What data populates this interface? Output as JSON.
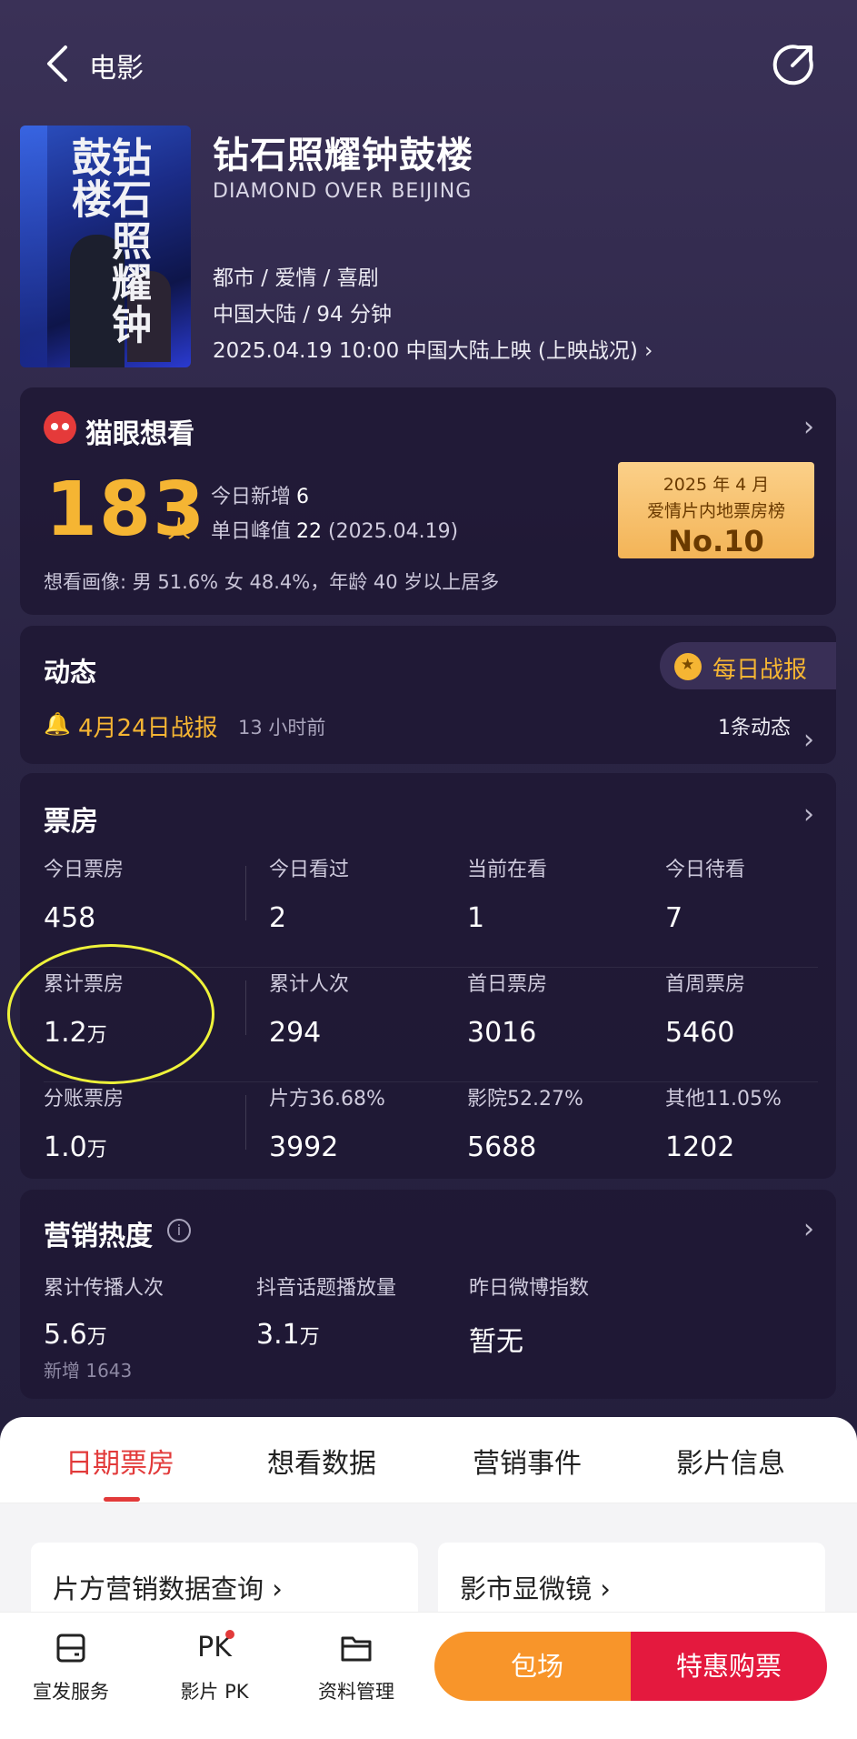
{
  "header": {
    "title": "电影"
  },
  "movie": {
    "title": "钻石照耀钟鼓楼",
    "title_en": "DIAMOND OVER BEIJING",
    "genres": "都市 / 爱情 / 喜剧",
    "region_duration": "中国大陆 / 94 分钟",
    "release": "2025.04.19 10:00 中国大陆上映 (上映战况)",
    "poster_title": "钻石照耀钟鼓楼"
  },
  "want": {
    "title": "猫眼想看",
    "count": "183",
    "unit": "人",
    "today_label": "今日新增",
    "today_value": "6",
    "peak_label": "单日峰值",
    "peak_value": "22",
    "peak_date": "(2025.04.19)",
    "persona": "想看画像: 男 51.6%  女 48.4%，年龄 40 岁以上居多",
    "rank_line1": "2025 年 4 月",
    "rank_line2": "爱情片内地票房榜",
    "rank_line3": "No.10"
  },
  "dynamics": {
    "title": "动态",
    "daily_button": "每日战报",
    "report": "4月24日战报",
    "time": "13 小时前",
    "count": "1条动态"
  },
  "box_office": {
    "title": "票房",
    "rows": [
      [
        {
          "label": "今日票房",
          "value": "458",
          "unit": ""
        },
        {
          "label": "今日看过",
          "value": "2",
          "unit": ""
        },
        {
          "label": "当前在看",
          "value": "1",
          "unit": ""
        },
        {
          "label": "今日待看",
          "value": "7",
          "unit": ""
        }
      ],
      [
        {
          "label": "累计票房",
          "value": "1.2",
          "unit": "万"
        },
        {
          "label": "累计人次",
          "value": "294",
          "unit": ""
        },
        {
          "label": "首日票房",
          "value": "3016",
          "unit": ""
        },
        {
          "label": "首周票房",
          "value": "5460",
          "unit": ""
        }
      ],
      [
        {
          "label": "分账票房",
          "value": "1.0",
          "unit": "万"
        },
        {
          "label": "片方36.68%",
          "value": "3992",
          "unit": ""
        },
        {
          "label": "影院52.27%",
          "value": "5688",
          "unit": ""
        },
        {
          "label": "其他11.05%",
          "value": "1202",
          "unit": ""
        }
      ]
    ]
  },
  "marketing": {
    "title": "营销热度",
    "items": [
      {
        "label": "累计传播人次",
        "value": "5.6",
        "unit": "万",
        "sub": "新增 1643"
      },
      {
        "label": "抖音话题播放量",
        "value": "3.1",
        "unit": "万",
        "sub": ""
      },
      {
        "label": "昨日微博指数",
        "value": "暂无",
        "unit": "",
        "sub": ""
      }
    ]
  },
  "tabs": [
    "日期票房",
    "想看数据",
    "营销事件",
    "影片信息"
  ],
  "tools": [
    "片方营销数据查询 ›",
    "影市显微镜 ›"
  ],
  "bottom_nav": [
    {
      "label": "宣发服务",
      "icon": "service-icon"
    },
    {
      "label": "影片 PK",
      "icon": "pk-icon",
      "glyph": "PK"
    },
    {
      "label": "资料管理",
      "icon": "folder-icon"
    }
  ],
  "buttons": {
    "charter": "包场",
    "buy": "特惠购票"
  },
  "colors": {
    "accent": "#e23a3a",
    "gold": "#f5b533",
    "orange": "#f8952a",
    "red": "#e4193e",
    "highlight": "#eef23a"
  }
}
